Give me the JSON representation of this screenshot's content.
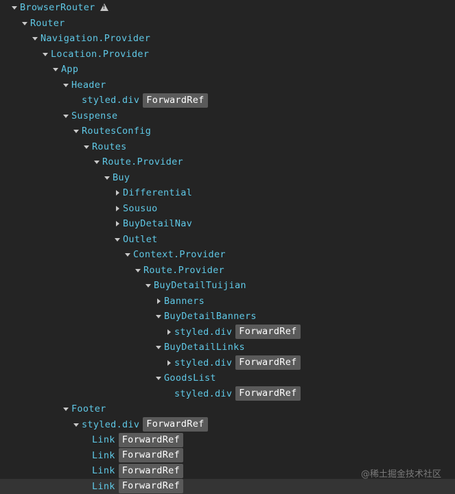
{
  "tree": [
    {
      "label": "BrowserRouter",
      "depth": 0,
      "state": "open",
      "warning": true
    },
    {
      "label": "Router",
      "depth": 1,
      "state": "open"
    },
    {
      "label": "Navigation.Provider",
      "depth": 2,
      "state": "open"
    },
    {
      "label": "Location.Provider",
      "depth": 3,
      "state": "open"
    },
    {
      "label": "App",
      "depth": 4,
      "state": "open"
    },
    {
      "label": "Header",
      "depth": 5,
      "state": "open"
    },
    {
      "label": "styled.div",
      "depth": 6,
      "state": "none",
      "badge": "ForwardRef"
    },
    {
      "label": "Suspense",
      "depth": 5,
      "state": "open"
    },
    {
      "label": "RoutesConfig",
      "depth": 6,
      "state": "open"
    },
    {
      "label": "Routes",
      "depth": 7,
      "state": "open"
    },
    {
      "label": "Route.Provider",
      "depth": 8,
      "state": "open"
    },
    {
      "label": "Buy",
      "depth": 9,
      "state": "open"
    },
    {
      "label": "Differential",
      "depth": 10,
      "state": "closed"
    },
    {
      "label": "Sousuo",
      "depth": 10,
      "state": "closed"
    },
    {
      "label": "BuyDetailNav",
      "depth": 10,
      "state": "closed"
    },
    {
      "label": "Outlet",
      "depth": 10,
      "state": "open"
    },
    {
      "label": "Context.Provider",
      "depth": 11,
      "state": "open"
    },
    {
      "label": "Route.Provider",
      "depth": 12,
      "state": "open"
    },
    {
      "label": "BuyDetailTuijian",
      "depth": 13,
      "state": "open"
    },
    {
      "label": "Banners",
      "depth": 14,
      "state": "closed"
    },
    {
      "label": "BuyDetailBanners",
      "depth": 14,
      "state": "open"
    },
    {
      "label": "styled.div",
      "depth": 15,
      "state": "closed",
      "badge": "ForwardRef"
    },
    {
      "label": "BuyDetailLinks",
      "depth": 14,
      "state": "open"
    },
    {
      "label": "styled.div",
      "depth": 15,
      "state": "closed",
      "badge": "ForwardRef"
    },
    {
      "label": "GoodsList",
      "depth": 14,
      "state": "open"
    },
    {
      "label": "styled.div",
      "depth": 15,
      "state": "none",
      "badge": "ForwardRef"
    },
    {
      "label": "Footer",
      "depth": 5,
      "state": "open"
    },
    {
      "label": "styled.div",
      "depth": 6,
      "state": "open",
      "badge": "ForwardRef"
    },
    {
      "label": "Link",
      "depth": 7,
      "state": "none",
      "badge": "ForwardRef"
    },
    {
      "label": "Link",
      "depth": 7,
      "state": "none",
      "badge": "ForwardRef"
    },
    {
      "label": "Link",
      "depth": 7,
      "state": "none",
      "badge": "ForwardRef"
    },
    {
      "label": "Link",
      "depth": 7,
      "state": "none",
      "badge": "ForwardRef",
      "selected": true
    }
  ],
  "watermark": "@稀土掘金技术社区",
  "colors": {
    "background": "#242424",
    "component_name": "#5fc8e6",
    "badge_bg": "#5a5a5a",
    "badge_text": "#ffffff",
    "selected_row": "#343434"
  }
}
